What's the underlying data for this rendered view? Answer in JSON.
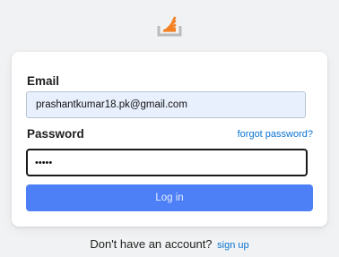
{
  "logo": {
    "icon": "stack-overflow-logo-icon",
    "accent_color": "#f48024",
    "tray_color": "#bcbbbb"
  },
  "form": {
    "email_label": "Email",
    "email_value": "prashantkumar18.pk@gmail.com",
    "password_label": "Password",
    "forgot_link": "forgot password?",
    "password_value": "•••••",
    "login_label": "Log in",
    "button_color": "#4d7ff6"
  },
  "signup": {
    "prompt": "Don't have an account?",
    "link": "sign up"
  }
}
